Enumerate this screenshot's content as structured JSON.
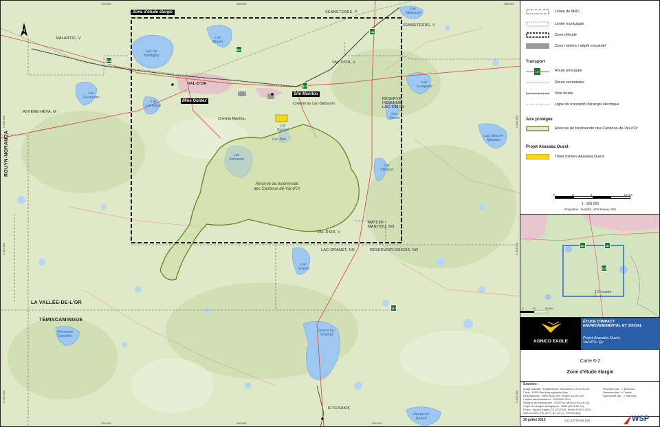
{
  "map": {
    "zone_label": "Zone d'étude élargie",
    "sites": {
      "val_dor": "VAL-D'OR",
      "mine_goldex": "Mine Goldex",
      "site_manitou": "Site Manitou"
    },
    "municipalities": {
      "malartic": "MALARTIC, V",
      "senneterre_p": "SENNETERRE, P",
      "senneterre": "SENNETERRE, V",
      "val_dor_v": "VAL-D'OR, V",
      "val_dor_v2": "VAL-D'OR, V",
      "riviere_heva": "RIVIÈRE-HÉVA, M",
      "lac_granet": "LAC-GRANET, NO",
      "reservoir_dozois": "RÉSERVOIR-DOZOIS, NO",
      "matchi": "MATCHI-\nMANITOU, NO",
      "reserve_indienne": "RÉSERVE\nINDIENNE\nLAC-SIMON",
      "kitcisakik": "KITCISAKIK"
    },
    "regions": {
      "rouyn": "ROUYN-NORANDA",
      "vallee": "LA VALLÉE-DE-L'OR",
      "temis": "TÉMISCAMINGUE"
    },
    "lakes": {
      "blouin": "Lac\nBlouin",
      "demontigny": "Lac De\nMontigny",
      "fournière": "Lac\nFournière",
      "lemoine": "Lac\nLemoine",
      "sabourin": "Lac\nSabourin",
      "ben": "Lac Ben",
      "baylys": "Lac\nBayeul",
      "villebon": "Lac\nVillebon",
      "simon": "Lac\nSimon",
      "gueguen": "Lac\nGuéguen",
      "matchi": "Lac Matchi-\nManitou",
      "tiblemont": "Lac\nTiblemont",
      "granet": "Lac\nGranet",
      "decelles": "Réservoir\nDecelles",
      "victoria": "Grand lac\nVictoria",
      "dozois": "Réservoir\nDozois",
      "lovel": "Lac\nLoven"
    },
    "roads": {
      "lac_sabourin": "Chemin du Lac-Sabourin",
      "manitou": "Chemin Manitou"
    },
    "reserve_label": "Réserve de biodiversité\ndes Caribous-de-Val-d'Or",
    "highways": [
      "111",
      "117",
      "397",
      "117",
      "117",
      "113",
      "117",
      "117",
      "111"
    ],
    "coords_top": [
      "376 000",
      "396 000",
      "368 000"
    ],
    "coords_bottom": [
      "376 000",
      "396 000",
      "526 000"
    ],
    "coords_left": [
      "5 332 000",
      "5 312 000",
      "5 292 000",
      "5 272 000"
    ],
    "coords_right": [
      "5 332 000",
      "5 312 000",
      "5 292 000"
    ]
  },
  "legend": {
    "items": [
      "Limite de MRC",
      "Limite municipale",
      "Zone d'étude",
      "Zone minière / dépôt industriel"
    ],
    "transport_title": "Transport",
    "transport": [
      "Route principale",
      "Route secondaire",
      "Voie ferrée",
      "Ligne de transport d'énergie électrique"
    ],
    "protected_title": "Aire protégée",
    "protected": [
      "Réserve de biodiversité des Caribous-de-Val-d'Or"
    ],
    "project_title": "Projet Akasaba Ouest",
    "project": [
      "Titres miniers Akasaba Ouest"
    ],
    "hwy_icon": "117",
    "scale_ticks": [
      "0",
      "3",
      "6",
      "12 Km"
    ],
    "scale_ratio": "1 : 300 000",
    "projection": "Projection : NAD83, UTM fuseau 18N"
  },
  "inset": {
    "scale": [
      "0",
      "25",
      "50 Km"
    ],
    "ci_contre": "Ci-contre",
    "highways": [
      "111",
      "117",
      "117"
    ]
  },
  "titleblock": {
    "company": "AGNICO EAGLE",
    "study": "ÉTUDE D'IMPACT\nENVIRONNEMENTAL ET SOCIAL",
    "project": "Projet Akasaba Ouest,\nVal-d'Or, Qc",
    "carte": "Carte 6-2",
    "carte_title": "Zone d'étude élargie",
    "sources_title": "Sources :",
    "sources": [
      "Image satellite : DigitalGlobe, Worldview2, 2013-10-03",
      "Carte : ESRI World topographic Map",
      "Hydrographie : MRN SDA 20K, feuillet 32C04-100",
      "Limites administratives : SDA20K-2011",
      "Réserve de biodiversité : GESTIM, MRN (2014-05-19)",
      "Projet de refuges biologiques : MRN (2014-02-11)",
      "Projet : Agnico Eagle ( 10-07-2015), fichier AGAO-1001-",
      "006-210-001_PA_OPT_A1_A4_A_UTM18.dwg"
    ],
    "prepared": "Préparée par : J. Marcoux",
    "drawn": "Dessinée par : V. Vaillie",
    "approved": "Approuvée par : J. Marcoux",
    "date": "30 juillet 2015",
    "ref": "141-14776-00-100",
    "wsp": "WSP"
  }
}
